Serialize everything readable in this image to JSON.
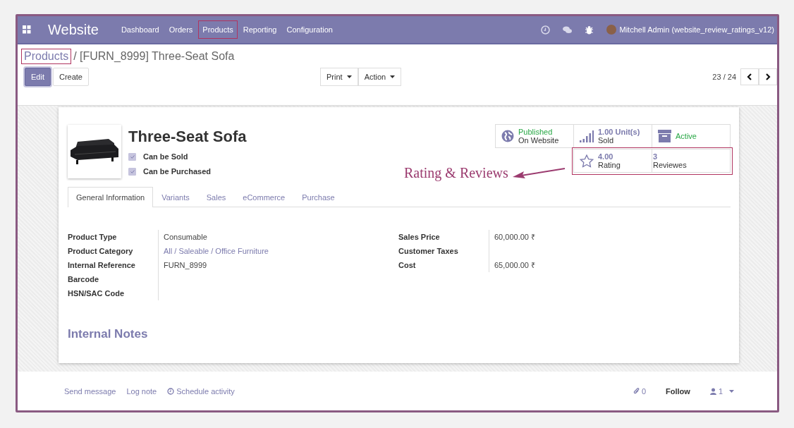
{
  "navbar": {
    "app": "Website",
    "menu": [
      {
        "label": "Dashboard",
        "highlighted": false
      },
      {
        "label": "Orders",
        "highlighted": false
      },
      {
        "label": "Products",
        "highlighted": true
      },
      {
        "label": "Reporting",
        "highlighted": false
      },
      {
        "label": "Configuration",
        "highlighted": false
      }
    ],
    "user": "Mitchell Admin (website_review_ratings_v12)"
  },
  "breadcrumb": {
    "parent": "Products",
    "parent_highlighted": true,
    "current": "/ [FURN_8999] Three-Seat Sofa"
  },
  "buttons": [
    {
      "label": "Edit",
      "kind": "primary"
    },
    {
      "label": "Create",
      "kind": "secondary"
    }
  ],
  "menus": [
    "Print",
    "Action"
  ],
  "pager": "23 / 24",
  "product": {
    "name": "Three-Seat Sofa",
    "options": [
      {
        "label": "Can be Sold",
        "checked": true
      },
      {
        "label": "Can be Purchased",
        "checked": true
      }
    ]
  },
  "stat_buttons": [
    {
      "kind": "publish",
      "value": "Published",
      "label": "On Website"
    },
    {
      "kind": "sold",
      "value": "1.00 Unit(s)",
      "label": "Sold"
    },
    {
      "kind": "active",
      "value": "Active"
    }
  ],
  "rating_group": {
    "highlighted": true,
    "buttons": [
      {
        "kind": "rating",
        "value": "4.00",
        "label": "Rating"
      },
      {
        "kind": "reviews",
        "value": "3",
        "label": "Reviewes"
      }
    ]
  },
  "annotation": {
    "text": "Rating & Reviews"
  },
  "tabs": [
    {
      "label": "General Information",
      "selected": true
    },
    {
      "label": "Variants",
      "selected": false
    },
    {
      "label": "Sales",
      "selected": false
    },
    {
      "label": "eCommerce",
      "selected": false
    },
    {
      "label": "Purchase",
      "selected": false
    }
  ],
  "left_fields": [
    {
      "label": "Product Type",
      "value": "Consumable",
      "kind": "text"
    },
    {
      "label": "Product Category",
      "value": "All / Saleable / Office Furniture",
      "kind": "link"
    },
    {
      "label": "Internal Reference",
      "value": "FURN_8999",
      "kind": "text"
    },
    {
      "label": "Barcode"
    },
    {
      "label": "HSN/SAC Code"
    }
  ],
  "right_fields": [
    {
      "label": "Sales Price",
      "value": "60,000.00 ₹"
    },
    {
      "label": "Customer Taxes"
    },
    {
      "label": "Cost",
      "value": "65,000.00 ₹"
    }
  ],
  "notes_title": "Internal Notes",
  "chatter": {
    "actions": [
      {
        "label": "Send message",
        "kind": "plain"
      },
      {
        "label": "Log note",
        "kind": "plain"
      },
      {
        "label": "Schedule activity",
        "kind": "clock"
      }
    ],
    "attachments": "0",
    "follow": "Follow",
    "followers": "1"
  }
}
